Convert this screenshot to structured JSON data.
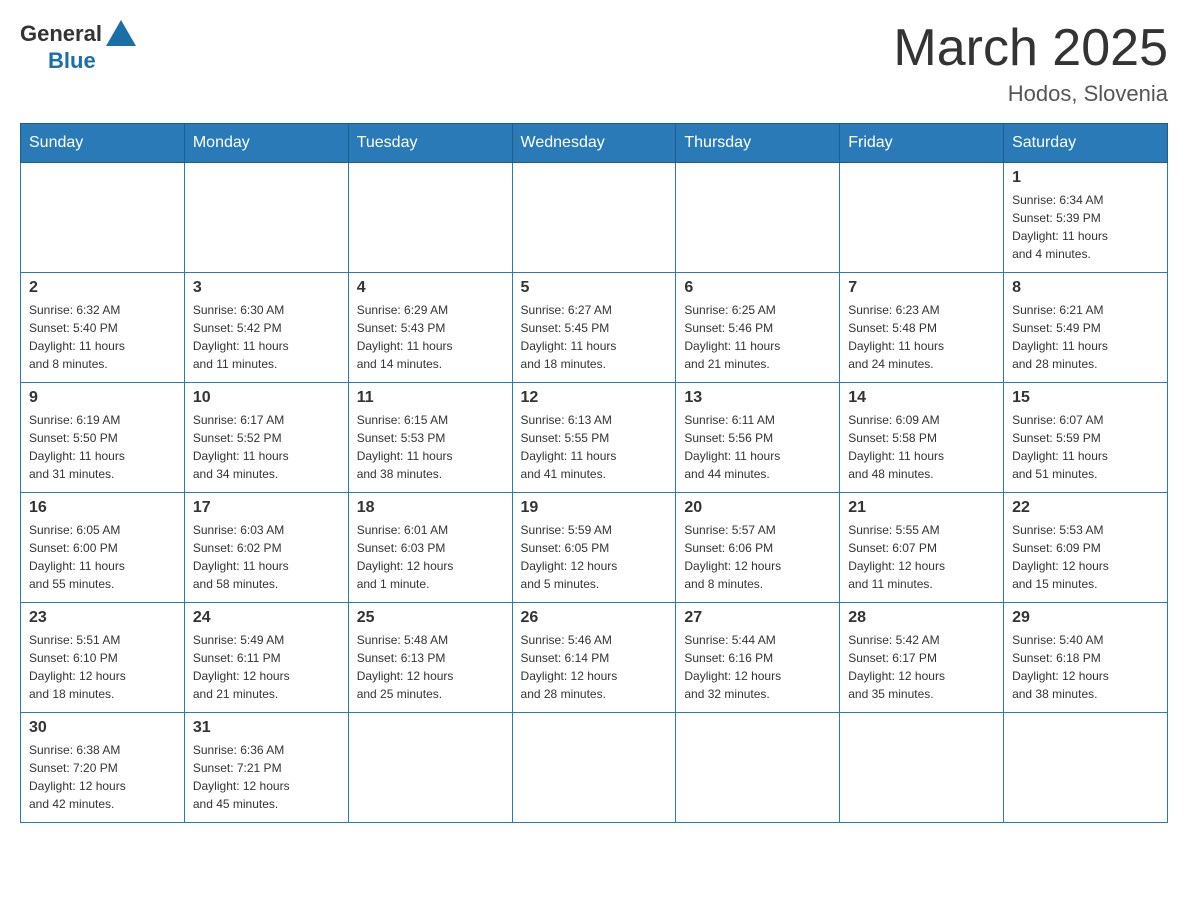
{
  "header": {
    "logo_general": "General",
    "logo_blue": "Blue",
    "title": "March 2025",
    "location": "Hodos, Slovenia"
  },
  "days_of_week": [
    "Sunday",
    "Monday",
    "Tuesday",
    "Wednesday",
    "Thursday",
    "Friday",
    "Saturday"
  ],
  "weeks": [
    [
      {
        "day": "",
        "info": ""
      },
      {
        "day": "",
        "info": ""
      },
      {
        "day": "",
        "info": ""
      },
      {
        "day": "",
        "info": ""
      },
      {
        "day": "",
        "info": ""
      },
      {
        "day": "",
        "info": ""
      },
      {
        "day": "1",
        "info": "Sunrise: 6:34 AM\nSunset: 5:39 PM\nDaylight: 11 hours\nand 4 minutes."
      }
    ],
    [
      {
        "day": "2",
        "info": "Sunrise: 6:32 AM\nSunset: 5:40 PM\nDaylight: 11 hours\nand 8 minutes."
      },
      {
        "day": "3",
        "info": "Sunrise: 6:30 AM\nSunset: 5:42 PM\nDaylight: 11 hours\nand 11 minutes."
      },
      {
        "day": "4",
        "info": "Sunrise: 6:29 AM\nSunset: 5:43 PM\nDaylight: 11 hours\nand 14 minutes."
      },
      {
        "day": "5",
        "info": "Sunrise: 6:27 AM\nSunset: 5:45 PM\nDaylight: 11 hours\nand 18 minutes."
      },
      {
        "day": "6",
        "info": "Sunrise: 6:25 AM\nSunset: 5:46 PM\nDaylight: 11 hours\nand 21 minutes."
      },
      {
        "day": "7",
        "info": "Sunrise: 6:23 AM\nSunset: 5:48 PM\nDaylight: 11 hours\nand 24 minutes."
      },
      {
        "day": "8",
        "info": "Sunrise: 6:21 AM\nSunset: 5:49 PM\nDaylight: 11 hours\nand 28 minutes."
      }
    ],
    [
      {
        "day": "9",
        "info": "Sunrise: 6:19 AM\nSunset: 5:50 PM\nDaylight: 11 hours\nand 31 minutes."
      },
      {
        "day": "10",
        "info": "Sunrise: 6:17 AM\nSunset: 5:52 PM\nDaylight: 11 hours\nand 34 minutes."
      },
      {
        "day": "11",
        "info": "Sunrise: 6:15 AM\nSunset: 5:53 PM\nDaylight: 11 hours\nand 38 minutes."
      },
      {
        "day": "12",
        "info": "Sunrise: 6:13 AM\nSunset: 5:55 PM\nDaylight: 11 hours\nand 41 minutes."
      },
      {
        "day": "13",
        "info": "Sunrise: 6:11 AM\nSunset: 5:56 PM\nDaylight: 11 hours\nand 44 minutes."
      },
      {
        "day": "14",
        "info": "Sunrise: 6:09 AM\nSunset: 5:58 PM\nDaylight: 11 hours\nand 48 minutes."
      },
      {
        "day": "15",
        "info": "Sunrise: 6:07 AM\nSunset: 5:59 PM\nDaylight: 11 hours\nand 51 minutes."
      }
    ],
    [
      {
        "day": "16",
        "info": "Sunrise: 6:05 AM\nSunset: 6:00 PM\nDaylight: 11 hours\nand 55 minutes."
      },
      {
        "day": "17",
        "info": "Sunrise: 6:03 AM\nSunset: 6:02 PM\nDaylight: 11 hours\nand 58 minutes."
      },
      {
        "day": "18",
        "info": "Sunrise: 6:01 AM\nSunset: 6:03 PM\nDaylight: 12 hours\nand 1 minute."
      },
      {
        "day": "19",
        "info": "Sunrise: 5:59 AM\nSunset: 6:05 PM\nDaylight: 12 hours\nand 5 minutes."
      },
      {
        "day": "20",
        "info": "Sunrise: 5:57 AM\nSunset: 6:06 PM\nDaylight: 12 hours\nand 8 minutes."
      },
      {
        "day": "21",
        "info": "Sunrise: 5:55 AM\nSunset: 6:07 PM\nDaylight: 12 hours\nand 11 minutes."
      },
      {
        "day": "22",
        "info": "Sunrise: 5:53 AM\nSunset: 6:09 PM\nDaylight: 12 hours\nand 15 minutes."
      }
    ],
    [
      {
        "day": "23",
        "info": "Sunrise: 5:51 AM\nSunset: 6:10 PM\nDaylight: 12 hours\nand 18 minutes."
      },
      {
        "day": "24",
        "info": "Sunrise: 5:49 AM\nSunset: 6:11 PM\nDaylight: 12 hours\nand 21 minutes."
      },
      {
        "day": "25",
        "info": "Sunrise: 5:48 AM\nSunset: 6:13 PM\nDaylight: 12 hours\nand 25 minutes."
      },
      {
        "day": "26",
        "info": "Sunrise: 5:46 AM\nSunset: 6:14 PM\nDaylight: 12 hours\nand 28 minutes."
      },
      {
        "day": "27",
        "info": "Sunrise: 5:44 AM\nSunset: 6:16 PM\nDaylight: 12 hours\nand 32 minutes."
      },
      {
        "day": "28",
        "info": "Sunrise: 5:42 AM\nSunset: 6:17 PM\nDaylight: 12 hours\nand 35 minutes."
      },
      {
        "day": "29",
        "info": "Sunrise: 5:40 AM\nSunset: 6:18 PM\nDaylight: 12 hours\nand 38 minutes."
      }
    ],
    [
      {
        "day": "30",
        "info": "Sunrise: 6:38 AM\nSunset: 7:20 PM\nDaylight: 12 hours\nand 42 minutes."
      },
      {
        "day": "31",
        "info": "Sunrise: 6:36 AM\nSunset: 7:21 PM\nDaylight: 12 hours\nand 45 minutes."
      },
      {
        "day": "",
        "info": ""
      },
      {
        "day": "",
        "info": ""
      },
      {
        "day": "",
        "info": ""
      },
      {
        "day": "",
        "info": ""
      },
      {
        "day": "",
        "info": ""
      }
    ]
  ]
}
